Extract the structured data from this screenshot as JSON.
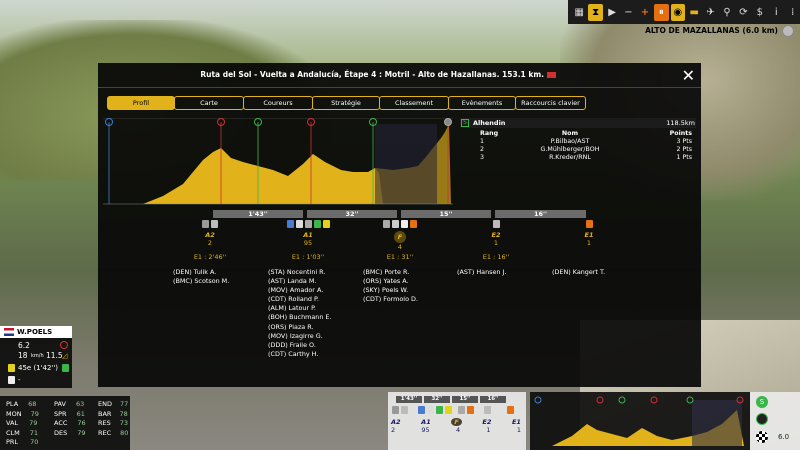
{
  "topbar": {
    "icons": [
      "calendar-icon",
      "hourglass-icon",
      "play-icon",
      "minus-icon",
      "plus-icon",
      "pause-icon",
      "eye-icon",
      "car-icon",
      "plane-icon",
      "motorbike-icon",
      "cycle-icon",
      "dollar-icon",
      "info-icon",
      "grid-icon"
    ]
  },
  "stage_label": "ALTO DE MAZALLANAS (6.0 km)",
  "modal": {
    "title": "Ruta del Sol - Vuelta a Andalucía, Étape 4 : Motril - Alto de Hazallanas. 153.1 km.",
    "tabs": [
      "Profil",
      "Carte",
      "Coureurs",
      "Stratégie",
      "Classement",
      "Evènements",
      "Raccourcis clavier"
    ],
    "classification": {
      "name": "Alhendin",
      "distance": "118.5km",
      "headers": [
        "Rang",
        "Nom",
        "Points"
      ],
      "rows": [
        [
          "1",
          "P.Bilbao/AST",
          "3 Pts"
        ],
        [
          "2",
          "G.Mühlberger/BOH",
          "2 Pts"
        ],
        [
          "3",
          "R.Kreder/RNL",
          "1 Pts"
        ]
      ]
    },
    "gaps": [
      "1'43''",
      "32''",
      "15''",
      "16''"
    ],
    "groups": [
      {
        "code": "A2",
        "count": "2",
        "time": "E1 : 2'46''",
        "names": "(DEN) Tulik A.\n(BMC) Scotson M."
      },
      {
        "code": "A1",
        "count": "95",
        "time": "E1 : 1'03''",
        "names": "(STA) Nocentini R.\n(AST) Landa M.\n(MOV) Amador A.\n(CDT) Rolland P.\n(ALM) Latour P.\n(BOH) Buchmann E.\n(ORS) Piaza R.\n(MOV) Izagirre G.\n(DDD) Fraile O.\n(CDT) Carthy H."
      },
      {
        "code": "F",
        "count": "4",
        "time": "E1 : 31''",
        "names": "(BMC) Porte R.\n(ORS) Yates A.\n(SKY) Poels W.\n(CDT) Formolo D."
      },
      {
        "code": "E2",
        "count": "1",
        "time": "E1 : 16''",
        "names": "(AST) Hansen J."
      },
      {
        "code": "E1",
        "count": "1",
        "time": "",
        "names": "(DEN) Kangert T."
      }
    ]
  },
  "rider": {
    "name": "W.POELS",
    "speed": "6.2",
    "kmh": "18",
    "unit": "km/h",
    "grade": "11.5",
    "position": "45e (1'42'')",
    "dash": "-"
  },
  "stats": {
    "cols": [
      [
        [
          "PLA",
          "68"
        ],
        [
          "MON",
          "79"
        ],
        [
          "VAL",
          "79"
        ],
        [
          "CLM",
          "71"
        ],
        [
          "PRL",
          "70"
        ]
      ],
      [
        [
          "PAV",
          "63"
        ],
        [
          "SPR",
          "61"
        ],
        [
          "ACC",
          "76"
        ],
        [
          "DES",
          "79"
        ]
      ],
      [
        [
          "END",
          "77"
        ],
        [
          "BAR",
          "78"
        ],
        [
          "RES",
          "73"
        ],
        [
          "REC",
          "80"
        ]
      ]
    ]
  },
  "mini": {
    "gaps": [
      "1'43''",
      "32''",
      "15''",
      "16''"
    ],
    "codes": [
      "A2",
      "A1",
      "F",
      "E2",
      "E1"
    ],
    "counts": [
      "2",
      "95",
      "4",
      "1",
      "1"
    ]
  },
  "mini3": {
    "dist": "6.0"
  },
  "colors": {
    "accent": "#e2b21a",
    "bg": "#0a0a0a",
    "orange": "#e47012",
    "green": "#3ab54a",
    "red": "#d03030"
  }
}
